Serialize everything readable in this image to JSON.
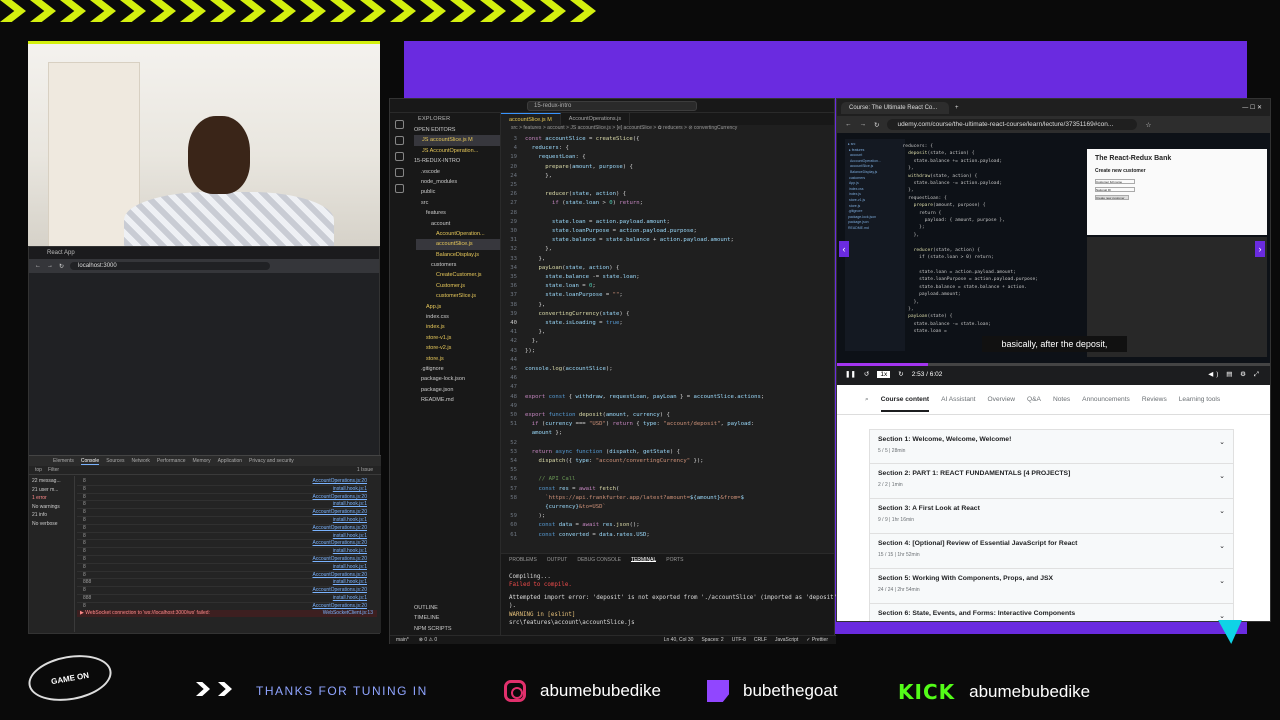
{
  "minibrowser": {
    "tab": "React App",
    "url": "localhost:3000"
  },
  "devtools": {
    "tabs": [
      "Elements",
      "Console",
      "Sources",
      "Network",
      "Performance",
      "Memory",
      "Application",
      "Privacy and security"
    ],
    "filter": "Filter",
    "top": "top",
    "issues": "1 Issue",
    "sidebar": [
      "22 messag...",
      "21 user m...",
      "1 error",
      "No warnings",
      "21 info",
      "No verbose"
    ],
    "rows": [
      {
        "n": "8",
        "src": "AccountOperations.js:20"
      },
      {
        "n": "8",
        "src": "install.hook.js:1"
      },
      {
        "n": "8",
        "src": "AccountOperations.js:20"
      },
      {
        "n": "8",
        "src": "install.hook.js:1"
      },
      {
        "n": "8",
        "src": "AccountOperations.js:20"
      },
      {
        "n": "8",
        "src": "install.hook.js:1"
      },
      {
        "n": "8",
        "src": "AccountOperations.js:20"
      },
      {
        "n": "8",
        "src": "install.hook.js:1"
      },
      {
        "n": "8",
        "src": "AccountOperations.js:20"
      },
      {
        "n": "8",
        "src": "install.hook.js:1"
      },
      {
        "n": "8",
        "src": "AccountOperations.js:20"
      },
      {
        "n": "8",
        "src": "install.hook.js:1"
      },
      {
        "n": "8",
        "src": "AccountOperations.js:20"
      },
      {
        "n": "888",
        "src": "install.hook.js:1"
      },
      {
        "n": "8",
        "src": "AccountOperations.js:20"
      },
      {
        "n": "888",
        "src": "install.hook.js:1"
      },
      {
        "n": "8",
        "src": "AccountOperations.js:20"
      }
    ],
    "error": "▶ WebSocket connection to 'ws://localhost:3000/ws' failed:",
    "error_src": "WebSocketClient.js:13"
  },
  "vscode": {
    "search": "15-redux-intro",
    "explorer": "EXPLORER",
    "open_editors": "OPEN EDITORS",
    "open_files": [
      "JS accountSlice.js M",
      "JS AccountOperation..."
    ],
    "project": "15-REDUX-INTRO",
    "tree": [
      ".vscode",
      "node_modules",
      "public",
      "src",
      "features",
      "account",
      "AccountOperation...",
      "accountSlice.js",
      "BalanceDisplay.js",
      "customers",
      "CreateCustomer.js",
      "Customer.js",
      "customerSlice.js",
      "App.js",
      "index.css",
      "index.js",
      "store-v1.js",
      "store-v2.js",
      "store.js",
      ".gitignore",
      "package-lock.json",
      "package.json",
      "README.md"
    ],
    "outline": "OUTLINE",
    "timeline": "TIMELINE",
    "npm": "NPM SCRIPTS",
    "tabs": [
      "accountSlice.js M",
      "AccountOperations.js"
    ],
    "breadcrumb": "src > features > account > JS accountSlice.js > [e] accountSlice > ✿ reducers > ⊘ convertingCurrency",
    "panel_tabs": [
      "PROBLEMS",
      "OUTPUT",
      "DEBUG CONSOLE",
      "TERMINAL",
      "PORTS"
    ],
    "terminal": {
      "l1": "Compiling...",
      "l2": "Failed to compile.",
      "l3": "Attempted import error: 'deposit' is not exported from './accountSlice' (imported as 'deposit'",
      "l4": ").",
      "l5": "WARNING in [eslint]",
      "l6": "src\\features\\account\\accountSlice.js"
    },
    "status": {
      "branch": "main*",
      "errors": "⊗ 0 ⚠ 0",
      "pos": "Ln 40, Col 30",
      "spaces": "Spaces: 2",
      "enc": "UTF-8",
      "eol": "CRLF",
      "lang": "JavaScript",
      "prettier": "✓ Prettier"
    }
  },
  "udemy": {
    "tab": "Course: The Ultimate React Co...",
    "url": "udemy.com/course/the-ultimate-react-course/learn/lecture/37351169#con...",
    "preview_title": "The React-Redux Bank",
    "preview_sub": "Create new customer",
    "preview_inputs": [
      "Customer full name",
      "National ID"
    ],
    "preview_button": "Create new customer",
    "caption": "basically, after the deposit,",
    "speed": "1x",
    "time": "2:53 / 6:02",
    "nav": [
      "Course content",
      "AI Assistant",
      "Overview",
      "Q&A",
      "Notes",
      "Announcements",
      "Reviews",
      "Learning tools"
    ],
    "sections": [
      {
        "title": "Section 1: Welcome, Welcome, Welcome!",
        "meta": "5 / 5 | 28min"
      },
      {
        "title": "Section 2: PART 1: REACT FUNDAMENTALS [4 PROJECTS]",
        "meta": "2 / 2 | 1min"
      },
      {
        "title": "Section 3: A First Look at React",
        "meta": "9 / 9 | 1hr 16min"
      },
      {
        "title": "Section 4: [Optional] Review of Essential JavaScript for React",
        "meta": "15 / 15 | 1hr 52min"
      },
      {
        "title": "Section 5: Working With Components, Props, and JSX",
        "meta": "24 / 24 | 2hr 54min"
      },
      {
        "title": "Section 6: State, Events, and Forms: Interactive Components",
        "meta": ""
      }
    ]
  },
  "footer": {
    "thanks": "THANKS FOR TUNING IN",
    "instagram": "abumebubedike",
    "twitch": "bubethegoat",
    "kick_label": "KICK",
    "kick": "abumebubedike"
  },
  "colors": {
    "accent": "#d4f00f",
    "frame": "#6a2be0",
    "kick": "#53fc18",
    "udemy": "#a435f0"
  }
}
